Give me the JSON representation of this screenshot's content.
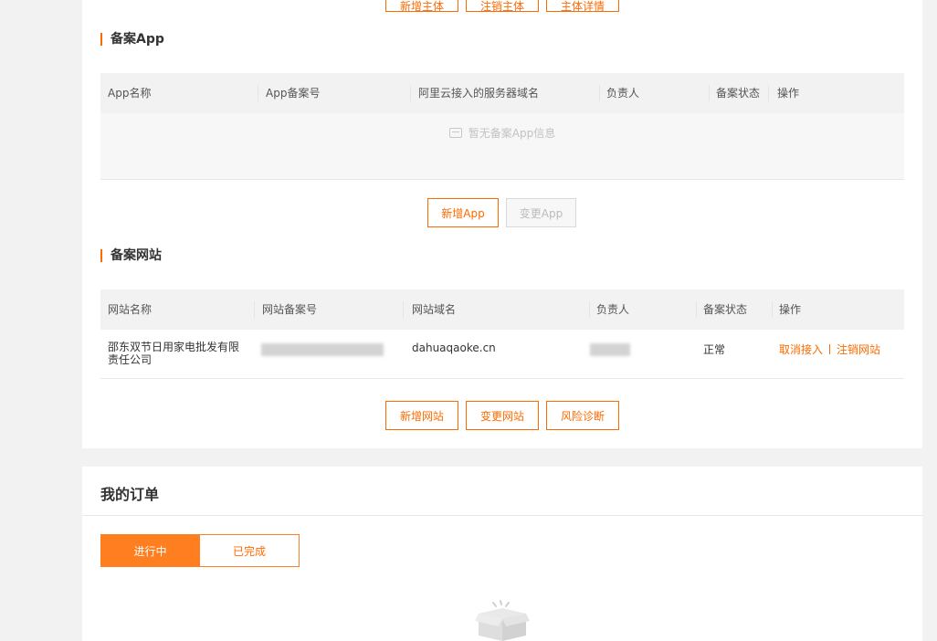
{
  "top_buttons": [
    "新增主体",
    "注销主体",
    "主体详情"
  ],
  "app_section": {
    "title": "备案App",
    "columns": [
      "App名称",
      "App备案号",
      "阿里云接入的服务器域名",
      "负责人",
      "备案状态",
      "操作"
    ],
    "empty_text": "暂无备案App信息",
    "add_button": "新增App",
    "change_button": "变更App"
  },
  "site_section": {
    "title": "备案网站",
    "columns": [
      "网站名称",
      "网站备案号",
      "网站域名",
      "负责人",
      "备案状态",
      "操作"
    ],
    "rows": [
      {
        "name": "邵东双节日用家电批发有限责任公司",
        "domain": "dahuaqaoke.cn",
        "status": "正常",
        "actions": [
          "取消接入",
          "注销网站"
        ]
      }
    ],
    "buttons": [
      "新增网站",
      "变更网站",
      "风险诊断"
    ]
  },
  "orders": {
    "title": "我的订单",
    "tabs": [
      "进行中",
      "已完成"
    ],
    "active_tab": "进行中"
  },
  "colors": {
    "accent": "#ff6a00",
    "active_tab_bg": "#ff7e1f",
    "header_bg": "#f2f2f2",
    "page_bg": "#f2f2f2"
  }
}
